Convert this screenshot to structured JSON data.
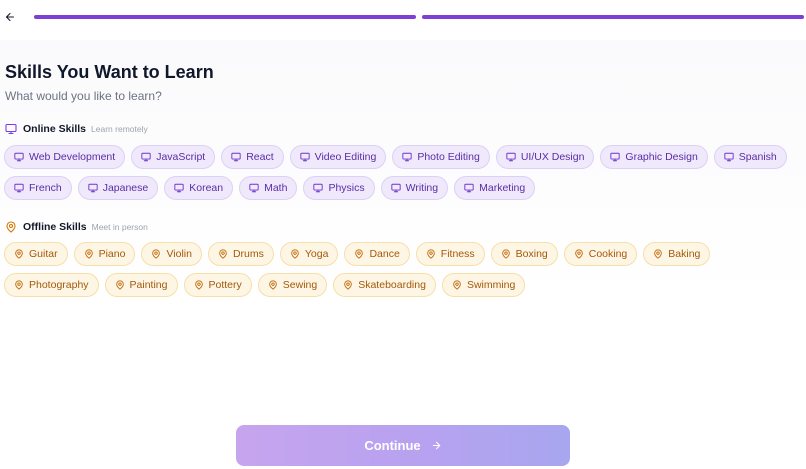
{
  "header": {
    "back_icon": "arrow-left-icon",
    "progress_steps": 2,
    "progress_completed": 2,
    "progress_color": "#7e3fd6"
  },
  "page": {
    "title": "Skills You Want to Learn",
    "subtitle": "What would you like to learn?"
  },
  "online": {
    "title": "Online Skills",
    "hint": "Learn remotely",
    "icon": "monitor-icon",
    "accent": "#7c3aed",
    "skills": [
      "Web Development",
      "JavaScript",
      "React",
      "Video Editing",
      "Photo Editing",
      "UI/UX Design",
      "Graphic Design",
      "Spanish",
      "French",
      "Japanese",
      "Korean",
      "Math",
      "Physics",
      "Writing",
      "Marketing"
    ]
  },
  "offline": {
    "title": "Offline Skills",
    "hint": "Meet in person",
    "icon": "map-pin-icon",
    "accent": "#d97706",
    "skills": [
      "Guitar",
      "Piano",
      "Violin",
      "Drums",
      "Yoga",
      "Dance",
      "Fitness",
      "Boxing",
      "Cooking",
      "Baking",
      "Photography",
      "Painting",
      "Pottery",
      "Sewing",
      "Skateboarding",
      "Swimming"
    ]
  },
  "footer": {
    "continue_label": "Continue",
    "continue_icon": "arrow-right-icon"
  }
}
